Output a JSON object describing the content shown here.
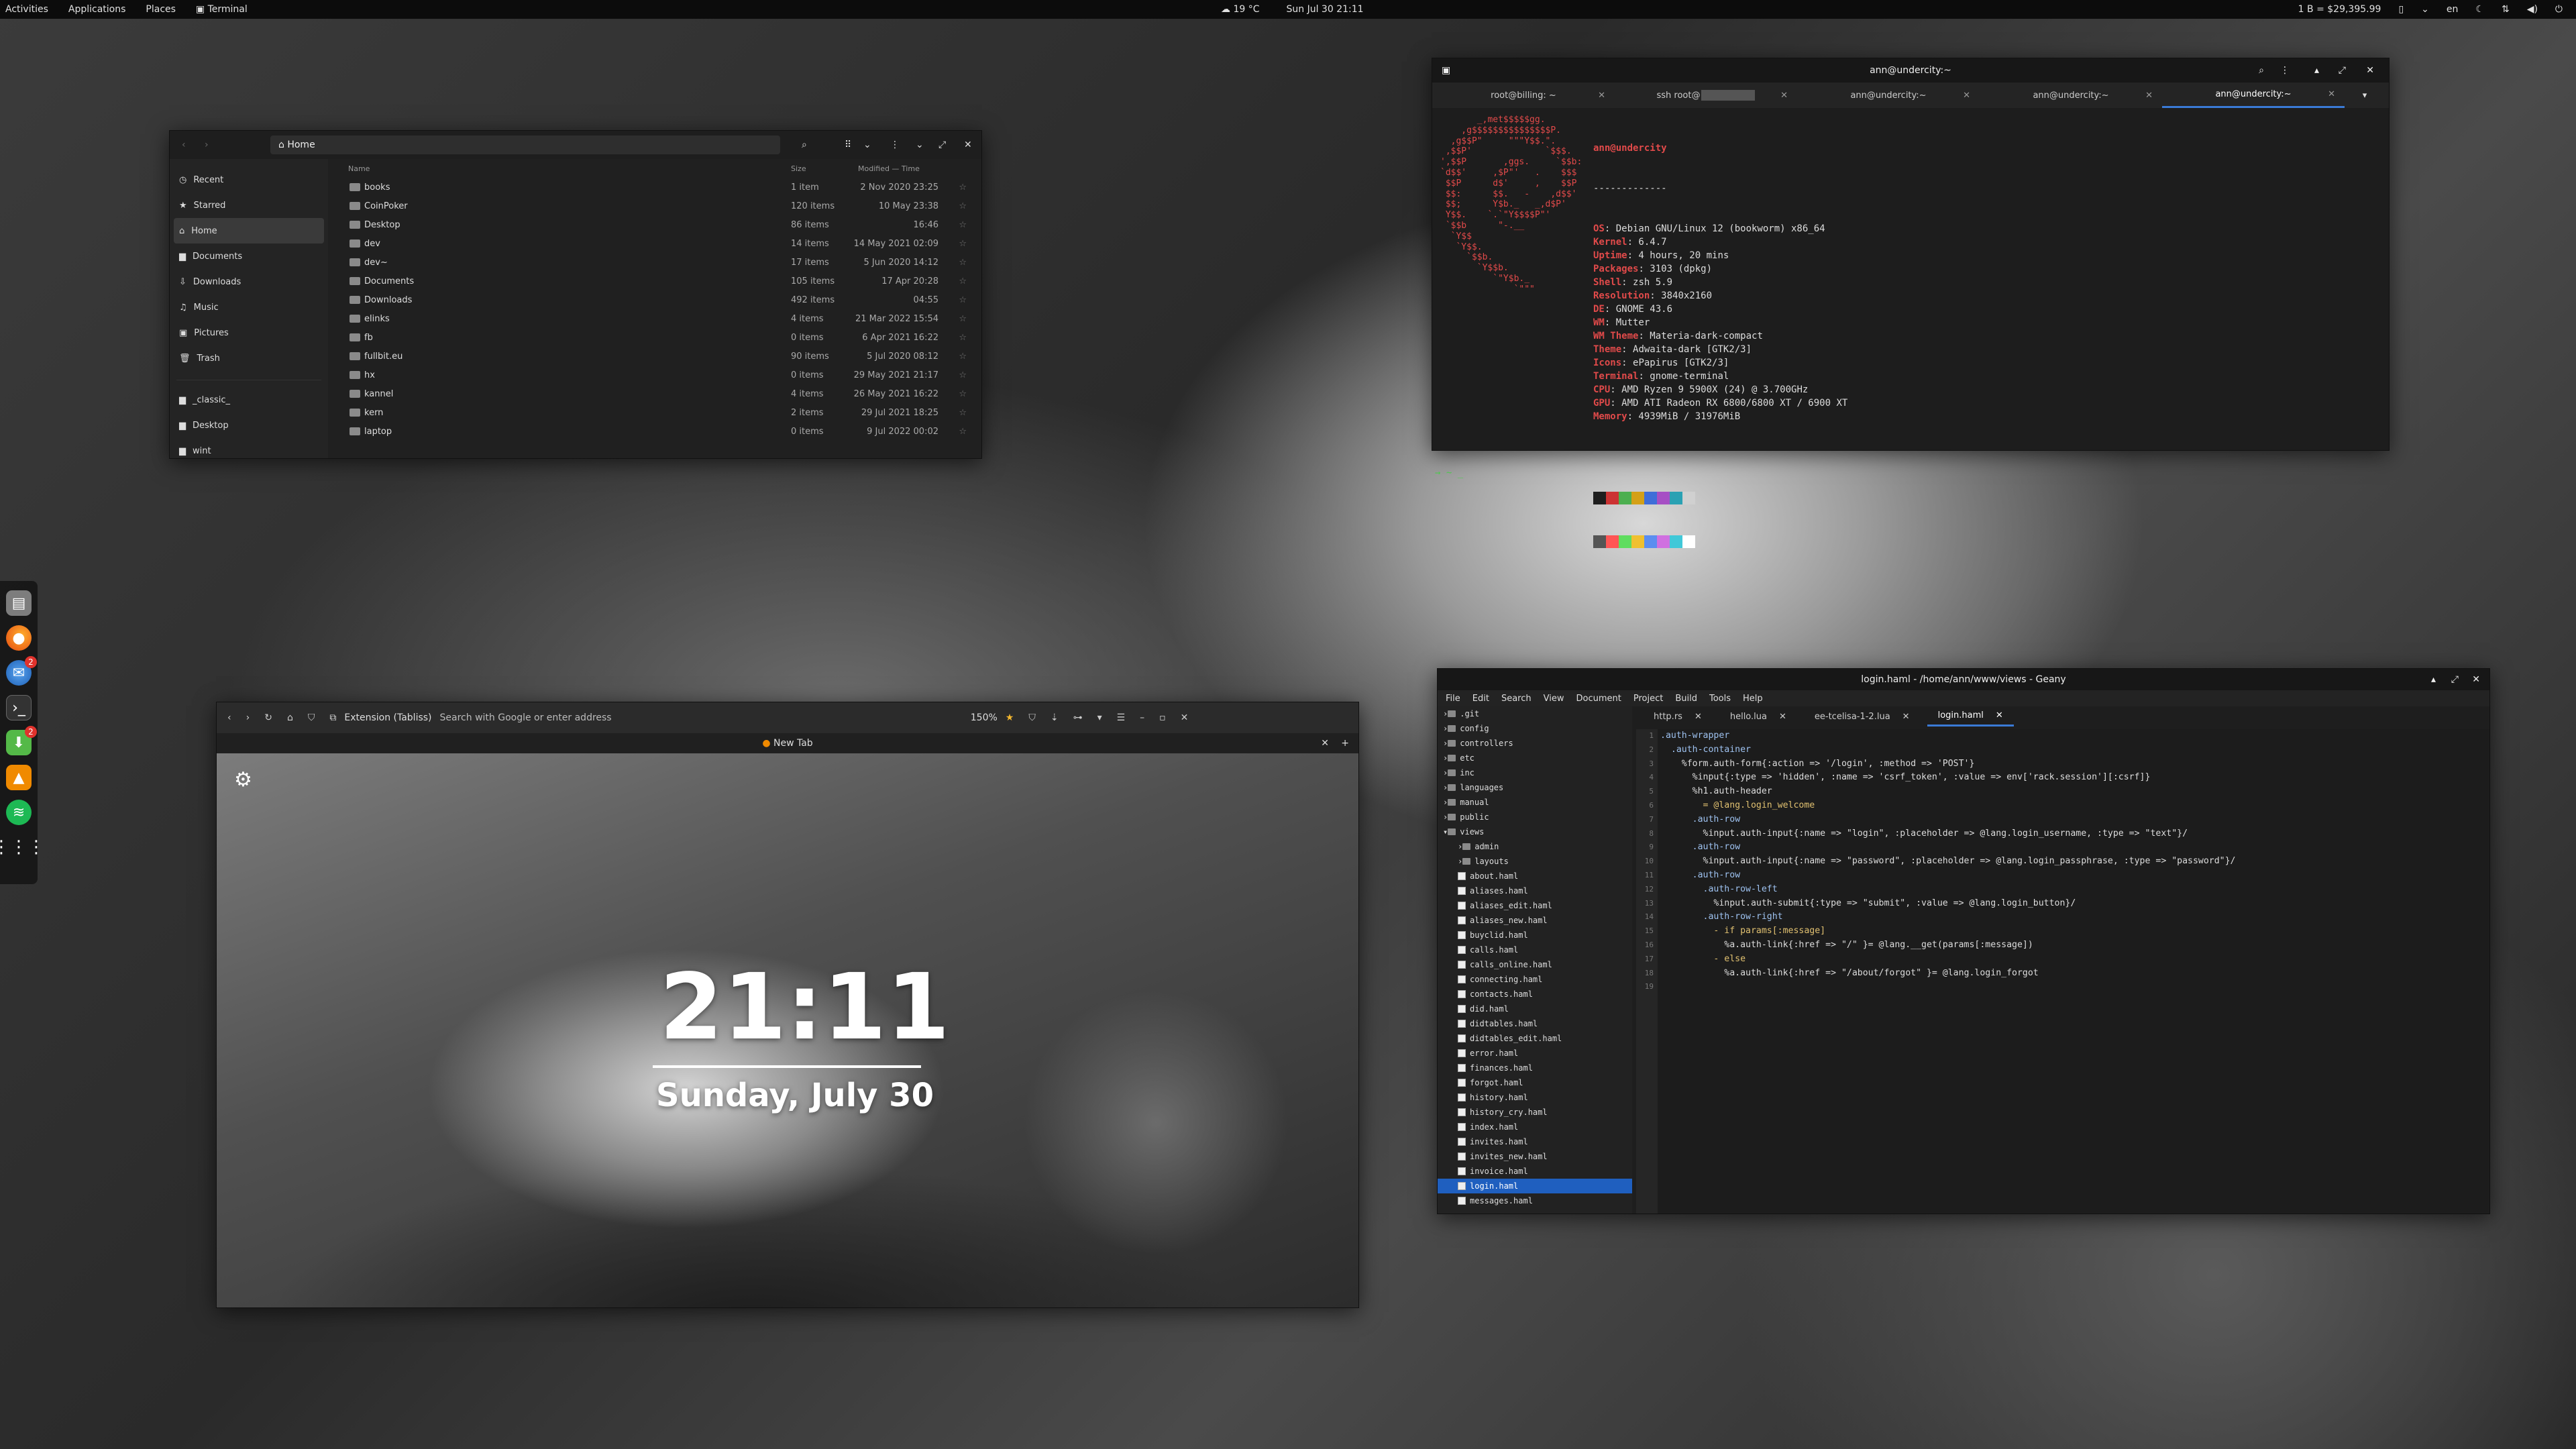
{
  "topbar": {
    "activities": "Activities",
    "applications": "Applications",
    "places": "Places",
    "terminal": "Terminal",
    "weather": "19 °C",
    "datetime": "Sun Jul 30  21:11",
    "crypto": "1 B = $29,395.99",
    "lang": "en"
  },
  "dock": {
    "badges": [
      "2",
      "2"
    ],
    "icons": [
      "files-icon",
      "firefox-icon",
      "thunderbird-icon",
      "terminal-icon",
      "software-icon",
      "vlc-icon",
      "spotify-icon",
      "apps-grid-icon"
    ]
  },
  "fm": {
    "path": "Home",
    "sidebar": [
      "Recent",
      "Starred",
      "Home",
      "Documents",
      "Downloads",
      "Music",
      "Pictures",
      "Trash",
      "_classic_",
      "Desktop",
      "wint"
    ],
    "cols": {
      "name": "Name",
      "size": "Size",
      "modified": "Modified — Time"
    },
    "rows": [
      {
        "n": "books",
        "s": "1 item",
        "m": "2 Nov 2020 23:25"
      },
      {
        "n": "CoinPoker",
        "s": "120 items",
        "m": "10 May 23:38"
      },
      {
        "n": "Desktop",
        "s": "86 items",
        "m": "16:46"
      },
      {
        "n": "dev",
        "s": "14 items",
        "m": "14 May 2021 02:09"
      },
      {
        "n": "dev~",
        "s": "17 items",
        "m": "5 Jun 2020 14:12"
      },
      {
        "n": "Documents",
        "s": "105 items",
        "m": "17 Apr 20:28"
      },
      {
        "n": "Downloads",
        "s": "492 items",
        "m": "04:55"
      },
      {
        "n": "elinks",
        "s": "4 items",
        "m": "21 Mar 2022 15:54"
      },
      {
        "n": "fb",
        "s": "0 items",
        "m": "6 Apr 2021 16:22"
      },
      {
        "n": "fullbit.eu",
        "s": "90 items",
        "m": "5 Jul 2020 08:12"
      },
      {
        "n": "hx",
        "s": "0 items",
        "m": "29 May 2021 21:17"
      },
      {
        "n": "kannel",
        "s": "4 items",
        "m": "26 May 2021 16:22"
      },
      {
        "n": "kern",
        "s": "2 items",
        "m": "29 Jul 2021 18:25"
      },
      {
        "n": "laptop",
        "s": "0 items",
        "m": "9 Jul 2022 00:02"
      }
    ]
  },
  "term": {
    "title": "ann@undercity:~",
    "tabs": [
      "root@billing: ~",
      "ssh root@",
      "ann@undercity:~",
      "ann@undercity:~",
      "ann@undercity:~"
    ],
    "user": "ann@undercity",
    "sep": "-------------",
    "info": [
      [
        "OS",
        "Debian GNU/Linux 12 (bookworm) x86_64"
      ],
      [
        "Kernel",
        "6.4.7"
      ],
      [
        "Uptime",
        "4 hours, 20 mins"
      ],
      [
        "Packages",
        "3103 (dpkg)"
      ],
      [
        "Shell",
        "zsh 5.9"
      ],
      [
        "Resolution",
        "3840x2160"
      ],
      [
        "DE",
        "GNOME 43.6"
      ],
      [
        "WM",
        "Mutter"
      ],
      [
        "WM Theme",
        "Materia-dark-compact"
      ],
      [
        "Theme",
        "Adwaita-dark [GTK2/3]"
      ],
      [
        "Icons",
        "ePapirus [GTK2/3]"
      ],
      [
        "Terminal",
        "gnome-terminal"
      ],
      [
        "CPU",
        "AMD Ryzen 9 5900X (24) @ 3.700GHz"
      ],
      [
        "GPU",
        "AMD ATI Radeon RX 6800/6800 XT / 6900 XT"
      ],
      [
        "Memory",
        "4939MiB / 31976MiB"
      ]
    ],
    "prompt": "→ ~ _",
    "swatches": [
      "#1e1e1e",
      "#cc3333",
      "#4caf50",
      "#d4a017",
      "#3f6ed8",
      "#a64fc4",
      "#2aa1b3",
      "#d0d0d0",
      "#555555",
      "#ff5555",
      "#5fdd5f",
      "#f0c030",
      "#5c8ef0",
      "#d070e0",
      "#40c8d8",
      "#ffffff"
    ]
  },
  "browser": {
    "url_ext": "Extension (Tabliss)",
    "url_placeholder": "Search with Google or enter address",
    "zoom": "150%",
    "tab": "New Tab",
    "time": "21:11",
    "date": "Sunday, July 30"
  },
  "geany": {
    "title": "login.haml - /home/ann/www/views - Geany",
    "menu": [
      "File",
      "Edit",
      "Search",
      "View",
      "Document",
      "Project",
      "Build",
      "Tools",
      "Help"
    ],
    "tabs": [
      "http.rs",
      "hello.lua",
      "ee-tcelisa-1-2.lua",
      "login.haml"
    ],
    "tree": [
      [
        ".git",
        0,
        "d"
      ],
      [
        "config",
        0,
        "d"
      ],
      [
        "controllers",
        0,
        "d"
      ],
      [
        "etc",
        0,
        "d"
      ],
      [
        "inc",
        0,
        "d"
      ],
      [
        "languages",
        0,
        "d"
      ],
      [
        "manual",
        0,
        "d"
      ],
      [
        "public",
        0,
        "d"
      ],
      [
        "views",
        0,
        "o"
      ],
      [
        "admin",
        1,
        "d"
      ],
      [
        "layouts",
        1,
        "d"
      ],
      [
        "about.haml",
        1,
        "f"
      ],
      [
        "aliases.haml",
        1,
        "f"
      ],
      [
        "aliases_edit.haml",
        1,
        "f"
      ],
      [
        "aliases_new.haml",
        1,
        "f"
      ],
      [
        "buyclid.haml",
        1,
        "f"
      ],
      [
        "calls.haml",
        1,
        "f"
      ],
      [
        "calls_online.haml",
        1,
        "f"
      ],
      [
        "connecting.haml",
        1,
        "f"
      ],
      [
        "contacts.haml",
        1,
        "f"
      ],
      [
        "did.haml",
        1,
        "f"
      ],
      [
        "didtables.haml",
        1,
        "f"
      ],
      [
        "didtables_edit.haml",
        1,
        "f"
      ],
      [
        "error.haml",
        1,
        "f"
      ],
      [
        "finances.haml",
        1,
        "f"
      ],
      [
        "forgot.haml",
        1,
        "f"
      ],
      [
        "history.haml",
        1,
        "f"
      ],
      [
        "history_cry.haml",
        1,
        "f"
      ],
      [
        "index.haml",
        1,
        "f"
      ],
      [
        "invites.haml",
        1,
        "f"
      ],
      [
        "invites_new.haml",
        1,
        "f"
      ],
      [
        "invoice.haml",
        1,
        "f"
      ],
      [
        "login.haml",
        1,
        "s"
      ],
      [
        "messages.haml",
        1,
        "f"
      ]
    ],
    "code": [
      ".auth-wrapper",
      "  .auth-container",
      "    %form.auth-form{:action => '/login', :method => 'POST'}",
      "      %input{:type => 'hidden', :name => 'csrf_token', :value => env['rack.session'][:csrf]}",
      "      %h1.auth-header",
      "        = @lang.login_welcome",
      "      .auth-row",
      "        %input.auth-input{:name => \"login\", :placeholder => @lang.login_username, :type => \"text\"}/",
      "      .auth-row",
      "        %input.auth-input{:name => \"password\", :placeholder => @lang.login_passphrase, :type => \"password\"}/",
      "      .auth-row",
      "        .auth-row-left",
      "          %input.auth-submit{:type => \"submit\", :value => @lang.login_button}/",
      "        .auth-row-right",
      "          - if params[:message]",
      "            %a.auth-link{:href => \"/\" }= @lang.__get(params[:message])",
      "          - else",
      "            %a.auth-link{:href => \"/about/forgot\" }= @lang.login_forgot",
      ""
    ]
  }
}
